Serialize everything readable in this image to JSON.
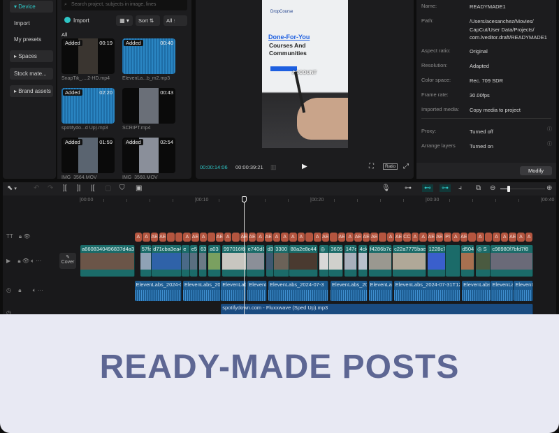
{
  "sidebar": {
    "device": "▾ Device",
    "import": "Import",
    "presets": "My presets",
    "spaces": "▸ Spaces",
    "stock": "Stock mate...",
    "brand": "▸ Brand assets"
  },
  "media": {
    "search_placeholder": "Search project, subjects in image, lines",
    "import": "Import",
    "sort": "Sort",
    "filter": "All",
    "section": "All",
    "items": [
      {
        "tag": "Added",
        "duration": "00:19",
        "name": "SnapTik_....2-HD.mp4",
        "type": "video",
        "color": "#3a3530"
      },
      {
        "tag": "Added",
        "duration": "00:40",
        "name": "ElevenLa...b_m2.mp3",
        "type": "audio"
      },
      {
        "tag": "Added",
        "duration": "02:20",
        "name": "spotifydo...d Up).mp3",
        "type": "audio"
      },
      {
        "tag": "",
        "duration": "00:43",
        "name": "SCRIPT.mp4",
        "type": "video",
        "color": "#6a6f78"
      },
      {
        "tag": "Added",
        "duration": "01:59",
        "name": "IMG_3564.MOV",
        "type": "video",
        "color": "#5a6470"
      },
      {
        "tag": "Added",
        "duration": "02:54",
        "name": "IMG_3568.MOV",
        "type": "video",
        "color": "#8a8f9a"
      }
    ]
  },
  "preview": {
    "brand": "DropCourse",
    "headline1": "Done-For-You",
    "headline2": "Courses And",
    "headline3": "Communities",
    "caption": "ACCOUNT",
    "current_time": "00:00:14:06",
    "total_time": "00:00:39:21",
    "ratio": "Ratio"
  },
  "details": {
    "rows": [
      {
        "label": "Name:",
        "value": "READYMADE1"
      },
      {
        "label": "Path:",
        "value": "/Users/acesanchez/Movies/ CapCut/User Data/Projects/ com.lveditor.draft/READYMADE1"
      },
      {
        "label": "Aspect ratio:",
        "value": "Original"
      },
      {
        "label": "Resolution:",
        "value": "Adapted"
      },
      {
        "label": "Color space:",
        "value": "Rec. 709 SDR"
      },
      {
        "label": "Frame rate:",
        "value": "30.00fps"
      },
      {
        "label": "Imported media:",
        "value": "Copy media to project"
      },
      {
        "label": "Proxy:",
        "value": "Turned off"
      },
      {
        "label": "Arrange layers",
        "value": "Turned on"
      }
    ],
    "modify": "Modify"
  },
  "timeline": {
    "ticks": [
      "|00:00",
      "|00:10",
      "|00:20",
      "|00:30",
      "|00:40"
    ],
    "playhead_sec": 14.2,
    "cover": "Cover",
    "text_chips": [
      "A",
      "A",
      "AE",
      "AE CA",
      "",
      "",
      "A",
      "AE",
      "A",
      "",
      "AE",
      "A",
      "",
      "AE",
      "AE",
      "A",
      "AE",
      "A",
      "A",
      "A",
      "A",
      "",
      "A",
      "AE",
      "",
      "AE",
      "A",
      "AE",
      "AE",
      "AE",
      "",
      "A",
      "AE",
      "CC",
      "A",
      "A",
      "AE",
      "AE",
      "PI",
      "A",
      "AE",
      "",
      "A",
      "",
      "A",
      "A",
      "AE",
      "A",
      "A"
    ],
    "video_clips": [
      {
        "name": "a6608340496837d4a3",
        "start": 0,
        "end": 4.7,
        "color": "#6b5548"
      },
      {
        "name": "57fa",
        "start": 5.2,
        "end": 6.2,
        "color": "#8fa2b5"
      },
      {
        "name": "d71cba3ea4",
        "start": 6.2,
        "end": 8.8,
        "color": "#2f62a8"
      },
      {
        "name": "e",
        "start": 8.8,
        "end": 9.5,
        "color": "#4a6a88"
      },
      {
        "name": "e5",
        "start": 9.5,
        "end": 10.2,
        "color": "#5a6f80"
      },
      {
        "name": "63",
        "start": 10.3,
        "end": 11,
        "color": "#6b7a86"
      },
      {
        "name": "a03",
        "start": 11.1,
        "end": 12.2,
        "color": "#7aa060"
      },
      {
        "name": "997016f8",
        "start": 12.3,
        "end": 14.4,
        "color": "#c8c6c0"
      },
      {
        "name": "e740d8",
        "start": 14.4,
        "end": 16,
        "color": "#8b8f98"
      },
      {
        "name": "d3",
        "start": 16.1,
        "end": 16.8,
        "color": "#3f5870"
      },
      {
        "name": "3300",
        "start": 16.8,
        "end": 18.1,
        "color": "#6b6258"
      },
      {
        "name": "88a2e8c44",
        "start": 18.1,
        "end": 20.6,
        "color": "#4a3a30"
      },
      {
        "name": "◎",
        "start": 20.7,
        "end": 21.6,
        "color": "#d8d8d8"
      },
      {
        "name": "3605",
        "start": 21.6,
        "end": 22.8,
        "color": "#d0d0cc"
      },
      {
        "name": "147e",
        "start": 22.9,
        "end": 24,
        "color": "#a8b0bc"
      },
      {
        "name": "4ck",
        "start": 24.1,
        "end": 24.9,
        "color": "#b8c0cc"
      },
      {
        "name": "f4286b7c",
        "start": 25,
        "end": 27,
        "color": "#9a9890"
      },
      {
        "name": "c22a7775bae",
        "start": 27.1,
        "end": 30,
        "color": "#b0a898"
      },
      {
        "name": "1228c7",
        "start": 30.1,
        "end": 31.7,
        "color": "#3a5fcc"
      },
      {
        "name": "",
        "start": 31.7,
        "end": 33,
        "color": "#1b6b69"
      },
      {
        "name": "d504",
        "start": 33,
        "end": 34.2,
        "color": "#a87050"
      },
      {
        "name": "◎ S",
        "start": 34.3,
        "end": 35.6,
        "color": "#4a5a40"
      },
      {
        "name": "c98980f7bfd7f8",
        "start": 35.6,
        "end": 39.3,
        "color": "#6a6a78"
      }
    ],
    "audio_clips": [
      {
        "name": "ElevenLabs_2024-0",
        "start": 4.7,
        "end": 8.8
      },
      {
        "name": "ElevenLabs_202",
        "start": 8.9,
        "end": 12.2
      },
      {
        "name": "ElevenLab",
        "start": 12.2,
        "end": 14.4
      },
      {
        "name": "ElevenLabs",
        "start": 14.5,
        "end": 16.2
      },
      {
        "name": "ElevenLabs_2024-07-3",
        "start": 16.3,
        "end": 21.5
      },
      {
        "name": "ElevenLabs_202",
        "start": 21.7,
        "end": 24.9
      },
      {
        "name": "ElevenLat",
        "start": 25,
        "end": 27.1
      },
      {
        "name": "ElevenLabs_2024-07-31T12_",
        "start": 27.2,
        "end": 33
      },
      {
        "name": "ElevenLabs_",
        "start": 33.1,
        "end": 35.6
      },
      {
        "name": "ElevenLal",
        "start": 35.6,
        "end": 37.6
      },
      {
        "name": "ElevenL",
        "start": 37.6,
        "end": 39.3
      }
    ],
    "music": {
      "name": "spotifydown.com - Fluxxwave (Sped Up).mp3",
      "start": 12.2,
      "end": 39.3
    }
  },
  "banner": {
    "title": "READY-MADE POSTS"
  },
  "colors": {
    "accent": "#2ec5c5",
    "banner_bg": "#e8e9f3",
    "banner_text": "#5d6693"
  }
}
